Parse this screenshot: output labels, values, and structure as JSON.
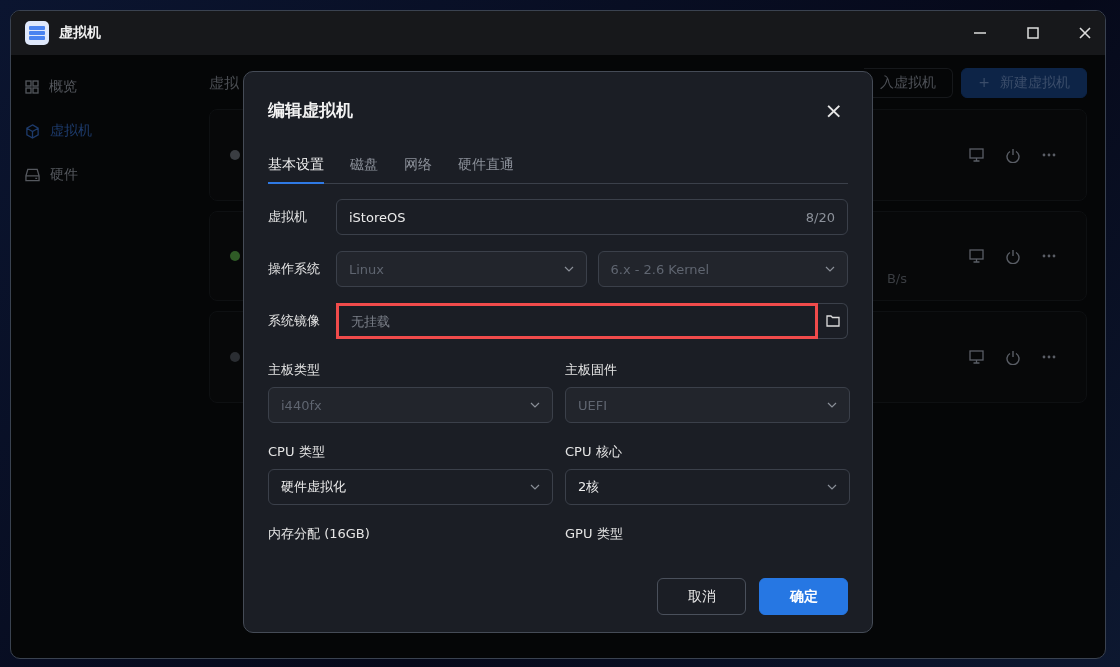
{
  "window": {
    "title": "虚拟机"
  },
  "sidebar": {
    "items": [
      {
        "label": "概览",
        "selected": false
      },
      {
        "label": "虚拟机",
        "selected": true
      },
      {
        "label": "硬件",
        "selected": false
      }
    ]
  },
  "main": {
    "heading": "虚拟",
    "buttons": [
      {
        "label": "入虚拟机",
        "kind": "secondary"
      },
      {
        "label": "新建虚拟机",
        "kind": "primary",
        "icon": "+"
      }
    ],
    "cards": [
      {
        "color": "#3a3d42"
      },
      {
        "color": "#2f5a26",
        "reading": "B/s"
      },
      {
        "color": "#2a2d32"
      }
    ]
  },
  "dialog": {
    "title": "编辑虚拟机",
    "close": "×",
    "tabs": [
      {
        "label": "基本设置",
        "selected": true
      },
      {
        "label": "磁盘",
        "selected": false
      },
      {
        "label": "网络",
        "selected": false
      },
      {
        "label": "硬件直通",
        "selected": false
      }
    ],
    "name": {
      "label": "虚拟机",
      "value": "iStoreOS",
      "count": "8/20"
    },
    "os": {
      "label": "操作系统",
      "type": {
        "value": "Linux",
        "disabled": true
      },
      "version": {
        "value": "6.x - 2.6 Kernel",
        "disabled": true
      }
    },
    "image": {
      "label": "系统镜像",
      "placeholder": "无挂载",
      "highlighted": true
    },
    "grid": [
      {
        "label": "主板类型",
        "value": "i440fx",
        "disabled": true
      },
      {
        "label": "主板固件",
        "value": "UEFI",
        "disabled": true
      },
      {
        "label": "CPU 类型",
        "value": "硬件虚拟化",
        "disabled": false
      },
      {
        "label": "CPU 核心",
        "value": "2核",
        "disabled": false
      }
    ],
    "more_labels": [
      "内存分配 (16GB)",
      "GPU 类型"
    ],
    "buttons": [
      {
        "label": "取消",
        "kind": "secondary"
      },
      {
        "label": "确定",
        "kind": "primary"
      }
    ]
  }
}
